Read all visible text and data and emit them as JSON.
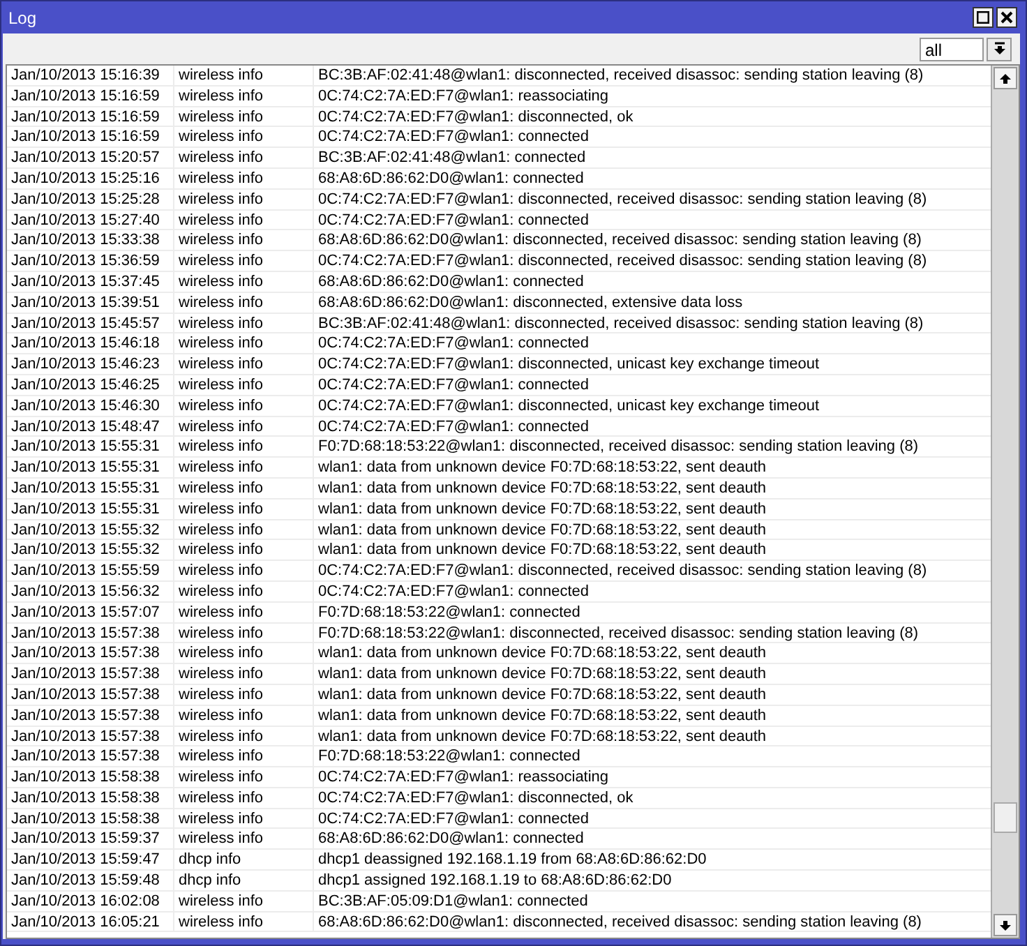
{
  "window": {
    "title": "Log",
    "buttons": [
      {
        "kind": "maximize"
      },
      {
        "kind": "close"
      }
    ]
  },
  "filter": {
    "value": "all"
  },
  "rows": [
    {
      "time": "Jan/10/2013 15:16:39",
      "topic": "wireless info",
      "message": "BC:3B:AF:02:41:48@wlan1: disconnected, received disassoc: sending station leaving (8)"
    },
    {
      "time": "Jan/10/2013 15:16:59",
      "topic": "wireless info",
      "message": "0C:74:C2:7A:ED:F7@wlan1: reassociating"
    },
    {
      "time": "Jan/10/2013 15:16:59",
      "topic": "wireless info",
      "message": "0C:74:C2:7A:ED:F7@wlan1: disconnected, ok"
    },
    {
      "time": "Jan/10/2013 15:16:59",
      "topic": "wireless info",
      "message": "0C:74:C2:7A:ED:F7@wlan1: connected"
    },
    {
      "time": "Jan/10/2013 15:20:57",
      "topic": "wireless info",
      "message": "BC:3B:AF:02:41:48@wlan1: connected"
    },
    {
      "time": "Jan/10/2013 15:25:16",
      "topic": "wireless info",
      "message": "68:A8:6D:86:62:D0@wlan1: connected"
    },
    {
      "time": "Jan/10/2013 15:25:28",
      "topic": "wireless info",
      "message": "0C:74:C2:7A:ED:F7@wlan1: disconnected, received disassoc: sending station leaving (8)"
    },
    {
      "time": "Jan/10/2013 15:27:40",
      "topic": "wireless info",
      "message": "0C:74:C2:7A:ED:F7@wlan1: connected"
    },
    {
      "time": "Jan/10/2013 15:33:38",
      "topic": "wireless info",
      "message": "68:A8:6D:86:62:D0@wlan1: disconnected, received disassoc: sending station leaving (8)"
    },
    {
      "time": "Jan/10/2013 15:36:59",
      "topic": "wireless info",
      "message": "0C:74:C2:7A:ED:F7@wlan1: disconnected, received disassoc: sending station leaving (8)"
    },
    {
      "time": "Jan/10/2013 15:37:45",
      "topic": "wireless info",
      "message": "68:A8:6D:86:62:D0@wlan1: connected"
    },
    {
      "time": "Jan/10/2013 15:39:51",
      "topic": "wireless info",
      "message": "68:A8:6D:86:62:D0@wlan1: disconnected, extensive data loss"
    },
    {
      "time": "Jan/10/2013 15:45:57",
      "topic": "wireless info",
      "message": "BC:3B:AF:02:41:48@wlan1: disconnected, received disassoc: sending station leaving (8)"
    },
    {
      "time": "Jan/10/2013 15:46:18",
      "topic": "wireless info",
      "message": "0C:74:C2:7A:ED:F7@wlan1: connected"
    },
    {
      "time": "Jan/10/2013 15:46:23",
      "topic": "wireless info",
      "message": "0C:74:C2:7A:ED:F7@wlan1: disconnected, unicast key exchange timeout"
    },
    {
      "time": "Jan/10/2013 15:46:25",
      "topic": "wireless info",
      "message": "0C:74:C2:7A:ED:F7@wlan1: connected"
    },
    {
      "time": "Jan/10/2013 15:46:30",
      "topic": "wireless info",
      "message": "0C:74:C2:7A:ED:F7@wlan1: disconnected, unicast key exchange timeout"
    },
    {
      "time": "Jan/10/2013 15:48:47",
      "topic": "wireless info",
      "message": "0C:74:C2:7A:ED:F7@wlan1: connected"
    },
    {
      "time": "Jan/10/2013 15:55:31",
      "topic": "wireless info",
      "message": "F0:7D:68:18:53:22@wlan1: disconnected, received disassoc: sending station leaving (8)"
    },
    {
      "time": "Jan/10/2013 15:55:31",
      "topic": "wireless info",
      "message": "wlan1: data from unknown device F0:7D:68:18:53:22, sent deauth"
    },
    {
      "time": "Jan/10/2013 15:55:31",
      "topic": "wireless info",
      "message": "wlan1: data from unknown device F0:7D:68:18:53:22, sent deauth"
    },
    {
      "time": "Jan/10/2013 15:55:31",
      "topic": "wireless info",
      "message": "wlan1: data from unknown device F0:7D:68:18:53:22, sent deauth"
    },
    {
      "time": "Jan/10/2013 15:55:32",
      "topic": "wireless info",
      "message": "wlan1: data from unknown device F0:7D:68:18:53:22, sent deauth"
    },
    {
      "time": "Jan/10/2013 15:55:32",
      "topic": "wireless info",
      "message": "wlan1: data from unknown device F0:7D:68:18:53:22, sent deauth"
    },
    {
      "time": "Jan/10/2013 15:55:59",
      "topic": "wireless info",
      "message": "0C:74:C2:7A:ED:F7@wlan1: disconnected, received disassoc: sending station leaving (8)"
    },
    {
      "time": "Jan/10/2013 15:56:32",
      "topic": "wireless info",
      "message": "0C:74:C2:7A:ED:F7@wlan1: connected"
    },
    {
      "time": "Jan/10/2013 15:57:07",
      "topic": "wireless info",
      "message": "F0:7D:68:18:53:22@wlan1: connected"
    },
    {
      "time": "Jan/10/2013 15:57:38",
      "topic": "wireless info",
      "message": "F0:7D:68:18:53:22@wlan1: disconnected, received disassoc: sending station leaving (8)"
    },
    {
      "time": "Jan/10/2013 15:57:38",
      "topic": "wireless info",
      "message": "wlan1: data from unknown device F0:7D:68:18:53:22, sent deauth"
    },
    {
      "time": "Jan/10/2013 15:57:38",
      "topic": "wireless info",
      "message": "wlan1: data from unknown device F0:7D:68:18:53:22, sent deauth"
    },
    {
      "time": "Jan/10/2013 15:57:38",
      "topic": "wireless info",
      "message": "wlan1: data from unknown device F0:7D:68:18:53:22, sent deauth"
    },
    {
      "time": "Jan/10/2013 15:57:38",
      "topic": "wireless info",
      "message": "wlan1: data from unknown device F0:7D:68:18:53:22, sent deauth"
    },
    {
      "time": "Jan/10/2013 15:57:38",
      "topic": "wireless info",
      "message": "wlan1: data from unknown device F0:7D:68:18:53:22, sent deauth"
    },
    {
      "time": "Jan/10/2013 15:57:38",
      "topic": "wireless info",
      "message": "F0:7D:68:18:53:22@wlan1: connected"
    },
    {
      "time": "Jan/10/2013 15:58:38",
      "topic": "wireless info",
      "message": "0C:74:C2:7A:ED:F7@wlan1: reassociating"
    },
    {
      "time": "Jan/10/2013 15:58:38",
      "topic": "wireless info",
      "message": "0C:74:C2:7A:ED:F7@wlan1: disconnected, ok"
    },
    {
      "time": "Jan/10/2013 15:58:38",
      "topic": "wireless info",
      "message": "0C:74:C2:7A:ED:F7@wlan1: connected"
    },
    {
      "time": "Jan/10/2013 15:59:37",
      "topic": "wireless info",
      "message": "68:A8:6D:86:62:D0@wlan1: connected"
    },
    {
      "time": "Jan/10/2013 15:59:47",
      "topic": "dhcp info",
      "message": "dhcp1 deassigned 192.168.1.19 from 68:A8:6D:86:62:D0"
    },
    {
      "time": "Jan/10/2013 15:59:48",
      "topic": "dhcp info",
      "message": "dhcp1 assigned 192.168.1.19 to 68:A8:6D:86:62:D0"
    },
    {
      "time": "Jan/10/2013 16:02:08",
      "topic": "wireless info",
      "message": "BC:3B:AF:05:09:D1@wlan1: connected"
    },
    {
      "time": "Jan/10/2013 16:05:21",
      "topic": "wireless info",
      "message": "68:A8:6D:86:62:D0@wlan1: disconnected, received disassoc: sending station leaving (8)"
    }
  ]
}
